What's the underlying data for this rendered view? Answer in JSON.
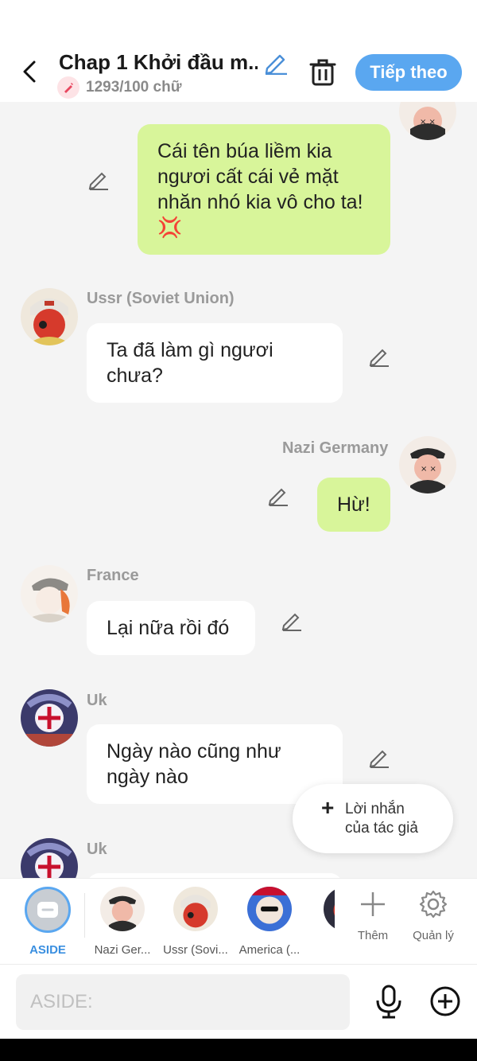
{
  "header": {
    "title": "Chap 1 Khởi đầu m...",
    "word_count": "1293/100 chữ",
    "next_label": "Tiếp theo"
  },
  "messages": [
    {
      "side": "me",
      "text": "Cái tên búa liềm kia ngươi cất cái vẻ mặt nhăn nhó kia vô cho ta!💢"
    },
    {
      "side": "other",
      "name": "Ussr (Soviet Union)",
      "text": "Ta đã làm gì ngươi chưa?"
    },
    {
      "side": "me",
      "name": "Nazi Germany",
      "text": "Hừ!"
    },
    {
      "side": "other",
      "name": "France",
      "text": "Lại nữa rồi đó"
    },
    {
      "side": "other",
      "name": "Uk",
      "text": "Ngày nào cũng như ngày nào"
    },
    {
      "side": "other",
      "name": "Uk",
      "text": ""
    }
  ],
  "author_note": {
    "line1": "Lời nhắn",
    "line2": "của tác giả"
  },
  "characters": [
    {
      "label": "ASIDE",
      "active": true
    },
    {
      "label": "Nazi Ger..."
    },
    {
      "label": "Ussr (Sovi..."
    },
    {
      "label": "America (..."
    }
  ],
  "tools": {
    "add_label": "Thêm",
    "manage_label": "Quản lý"
  },
  "input": {
    "placeholder": "ASIDE:"
  },
  "colors": {
    "accent": "#5aa7f0",
    "my_bubble": "#d8f59a",
    "other_bubble": "#ffffff",
    "background": "#f4f4f4"
  }
}
